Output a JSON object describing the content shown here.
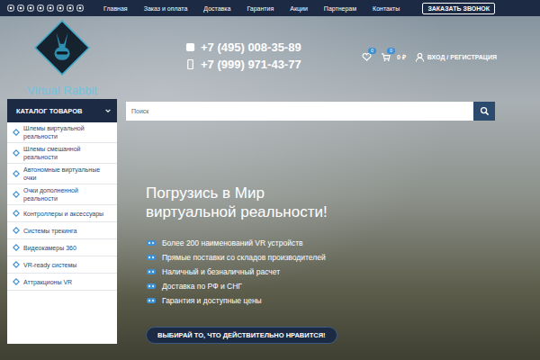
{
  "top_bar": {
    "nav": [
      "Главная",
      "Заказ и оплата",
      "Доставка",
      "Гарантия",
      "Акции",
      "Партнерам",
      "Контакты"
    ],
    "callback_button": "ЗАКАЗАТЬ ЗВОНОК"
  },
  "logo": {
    "text": "Virtual Rabbit"
  },
  "phones": [
    "+7 (495) 008-35-89",
    "+7 (999) 971-43-77"
  ],
  "user_bar": {
    "wishlist_count": "0",
    "cart_count": "0",
    "cart_total": "0 ₽",
    "login": "ВХОД / РЕГИСТРАЦИЯ"
  },
  "catalog": {
    "title": "КАТАЛОГ ТОВАРОВ",
    "items": [
      "Шлемы виртуальной реальности",
      "Шлемы смешанной реальности",
      "Автономные виртуальные очки",
      "Очки дополненной реальности",
      "Контроллеры и аксессуары",
      "Системы трекинга",
      "Видеокамеры 360",
      "VR-ready системы",
      "Аттракционы VR"
    ]
  },
  "search": {
    "placeholder": "Поиск"
  },
  "hero": {
    "title_lines": [
      "Погрузись в Мир",
      "виртуальной реальности!"
    ],
    "features": [
      "Более 200 наименований VR устройств",
      "Прямые поставки со складов производителей",
      "Наличный и безналичный расчет",
      "Доставка по РФ и СНГ",
      "Гарантия и доступные цены"
    ],
    "button": "ВЫБИРАЙ ТО, ЧТО ДЕЙСТВИТЕЛЬНО НРАВИТСЯ!"
  }
}
